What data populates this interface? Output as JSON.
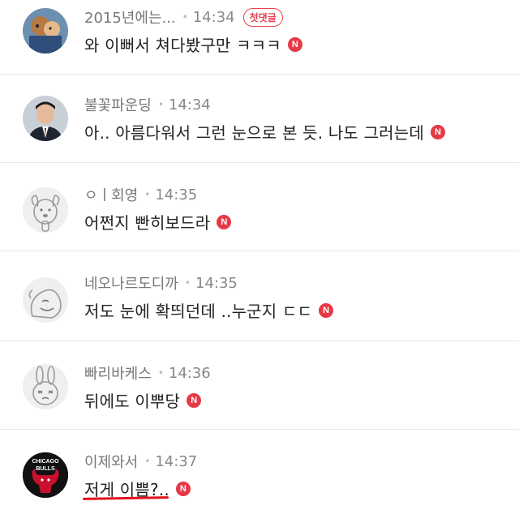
{
  "comments": [
    {
      "nickname": "2015년에는...",
      "time": "14:34",
      "badge": "첫댓글",
      "text": "와 이뻐서 쳐다봤구만 ㅋㅋㅋ",
      "new_label": "N",
      "avatar": "cartoon-couple-avatar"
    },
    {
      "nickname": "불꽃파운딩",
      "time": "14:34",
      "text": "아.. 아름다워서 그런 눈으로 본 듯. 나도 그러는데",
      "new_label": "N",
      "avatar": "man-in-suit-avatar"
    },
    {
      "nickname": "ㅇㅣ회영",
      "time": "14:35",
      "text": "어쩐지 빤히보드라",
      "new_label": "N",
      "avatar": "default-dog-avatar"
    },
    {
      "nickname": "네오나르도디까",
      "time": "14:35",
      "text": "저도 눈에 확띄던데 ..누군지 ㄷㄷ",
      "new_label": "N",
      "avatar": "default-blob-avatar"
    },
    {
      "nickname": "빠리바케스",
      "time": "14:36",
      "text": "뒤에도 이뿌당",
      "new_label": "N",
      "avatar": "default-rabbit-avatar"
    },
    {
      "nickname": "이제와서",
      "time": "14:37",
      "text": "저게 이쁨?..",
      "new_label": "N",
      "avatar": "chicago-bulls-avatar",
      "avatar_text": [
        "CHICAGO",
        "BULLS"
      ]
    }
  ],
  "colors": {
    "accent": "#e63946",
    "divider": "#e6e6e6",
    "underline": "#e0141c"
  }
}
